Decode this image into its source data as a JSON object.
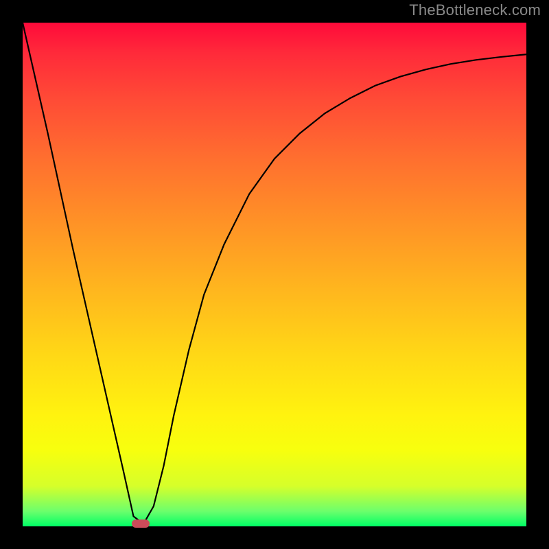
{
  "watermark": "TheBottleneck.com",
  "chart_data": {
    "type": "line",
    "title": "",
    "xlabel": "",
    "ylabel": "",
    "xlim": [
      0,
      100
    ],
    "ylim": [
      0,
      100
    ],
    "grid": false,
    "legend": false,
    "series": [
      {
        "name": "curve",
        "x": [
          0,
          5,
          10,
          15,
          20,
          22,
          24,
          26,
          28,
          30,
          33,
          36,
          40,
          45,
          50,
          55,
          60,
          65,
          70,
          75,
          80,
          85,
          90,
          95,
          100
        ],
        "y": [
          100,
          78,
          55,
          33,
          11,
          2,
          0.5,
          4,
          12,
          22,
          35,
          46,
          56,
          66,
          73,
          78,
          82,
          85,
          87.5,
          89.3,
          90.7,
          91.8,
          92.6,
          93.2,
          93.7
        ]
      }
    ],
    "marker": {
      "x": 23.5,
      "y": 0.6,
      "shape": "capsule",
      "color": "#cc4b5a"
    },
    "gradient_stops": [
      {
        "pct": 0,
        "color": "#ff0a3a"
      },
      {
        "pct": 50,
        "color": "#ffb61e"
      },
      {
        "pct": 80,
        "color": "#fff30f"
      },
      {
        "pct": 100,
        "color": "#00ff66"
      }
    ]
  }
}
